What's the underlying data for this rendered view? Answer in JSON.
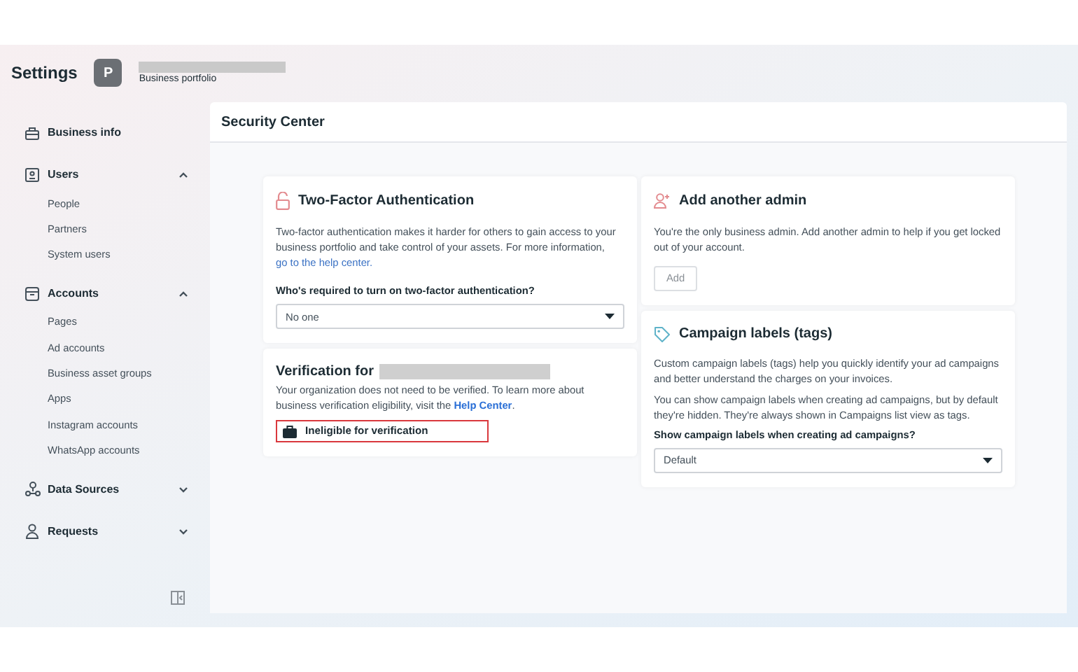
{
  "header": {
    "title": "Settings",
    "avatar_letter": "P",
    "portfolio_label": "Business portfolio"
  },
  "sidebar": {
    "items": [
      {
        "label": "Business info"
      },
      {
        "label": "Users",
        "expanded": true,
        "children": [
          {
            "label": "People"
          },
          {
            "label": "Partners"
          },
          {
            "label": "System users"
          }
        ]
      },
      {
        "label": "Accounts",
        "expanded": true,
        "children": [
          {
            "label": "Pages"
          },
          {
            "label": "Ad accounts"
          },
          {
            "label": "Business asset groups"
          },
          {
            "label": "Apps"
          },
          {
            "label": "Instagram accounts"
          },
          {
            "label": "WhatsApp accounts"
          }
        ]
      },
      {
        "label": "Data Sources",
        "expanded": false
      },
      {
        "label": "Requests",
        "expanded": false
      }
    ]
  },
  "main": {
    "title": "Security Center",
    "two_factor": {
      "title": "Two-Factor Authentication",
      "text": "Two-factor authentication makes it harder for others to gain access to your business portfolio and take control of your assets. For more information, ",
      "link": "go to the help center.",
      "question": "Who's required to turn on two-factor authentication?",
      "value": "No one"
    },
    "verification": {
      "title": "Verification for",
      "text": "Your organization does not need to be verified. To learn more about business verification eligibility, visit the ",
      "link": "Help Center",
      "text_end": ".",
      "status": "Ineligible for verification"
    },
    "admin": {
      "title": "Add another admin",
      "text": "You're the only business admin. Add another admin to help if you get locked out of your account.",
      "button": "Add"
    },
    "labels": {
      "title": "Campaign labels (tags)",
      "text1": "Custom campaign labels (tags) help you quickly identify your ad campaigns and better understand the charges on your invoices.",
      "text2": "You can show campaign labels when creating ad campaigns, but by default they're hidden. They're always shown in Campaigns list view as tags.",
      "question": "Show campaign labels when creating ad campaigns?",
      "value": "Default"
    }
  }
}
